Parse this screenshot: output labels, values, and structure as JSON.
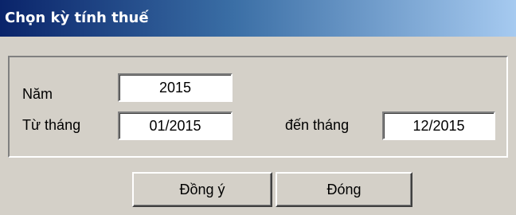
{
  "window": {
    "title": "Chọn kỳ tính thuế"
  },
  "form": {
    "year_label": "Năm",
    "year_value": "2015",
    "from_label": "Từ tháng",
    "from_value": "01/2015",
    "to_label": "đến tháng",
    "to_value": "12/2015"
  },
  "buttons": {
    "ok_label": "Đồng ý",
    "close_label": "Đóng"
  },
  "colors": {
    "titlebar_start": "#0a246a",
    "titlebar_end": "#a6caf0",
    "window_bg": "#d4d0c8"
  }
}
